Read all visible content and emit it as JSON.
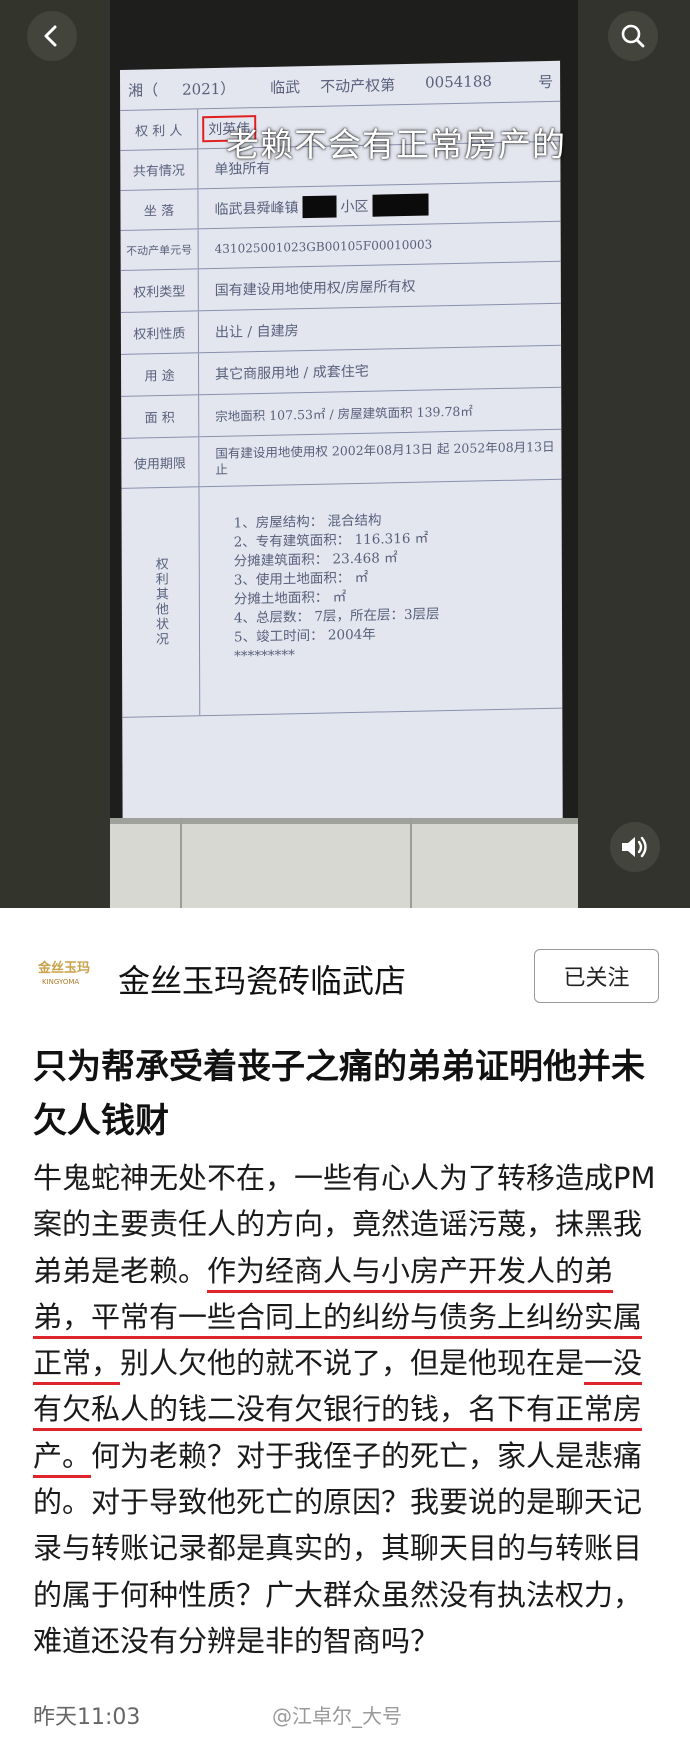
{
  "video": {
    "overlay_caption": "老赖不会有正常房产的",
    "document": {
      "header": {
        "prefix": "湘（",
        "year": "2021）",
        "county": "临武",
        "type": "不动产权第",
        "number": "0054188",
        "suffix": "号"
      },
      "rows": [
        {
          "label": "权 利 人",
          "value": "刘英伟"
        },
        {
          "label": "共有情况",
          "value": "单独所有"
        },
        {
          "label": "坐 落",
          "value_prefix": "临武县舜峰镇",
          "value_mid": "小区"
        },
        {
          "label": "不动产单元号",
          "value": "431025001023GB00105F00010003"
        },
        {
          "label": "权利类型",
          "value": "国有建设用地使用权/房屋所有权"
        },
        {
          "label": "权利性质",
          "value": "出让 / 自建房"
        },
        {
          "label": "用 途",
          "value": "其它商服用地 / 成套住宅"
        },
        {
          "label": "面 积",
          "value": "宗地面积 107.53㎡ / 房屋建筑面积 139.78㎡"
        },
        {
          "label": "使用期限",
          "value": "国有建设用地使用权 2002年08月13日 起 2052年08月13日 止"
        }
      ],
      "other_label": "权利其他状况",
      "other_items": [
        "1、房屋结构：  混合结构",
        "2、专有建筑面积：  116.316 ㎡",
        "   分摊建筑面积：  23.468 ㎡",
        "3、使用土地面积：  ㎡",
        "   分摊土地面积：  ㎡",
        "4、总层数：  7层，所在层：3层层",
        "5、竣工时间：  2004年",
        "*********"
      ]
    }
  },
  "top_bar": {
    "back_icon": "chevron-left-icon",
    "search_icon": "search-icon"
  },
  "sound_icon": "speaker-icon",
  "account": {
    "name": "金丝玉玛瓷砖临武店",
    "logo_text": "金丝玉玛",
    "logo_sub": "KINGYOMA",
    "follow_label": "已关注"
  },
  "post": {
    "title": "只为帮承受着丧子之痛的弟弟证明他并未欠人钱财",
    "p1": "牛鬼蛇神无处不在，一些有心人为了转移造成PM案的主要责任人的方向，竟然造谣污蔑，抹黑我弟弟是老赖。",
    "u1": "作为经商人与小房产开发人的弟弟，平常有一些合同上的纠纷与债务上纠纷实属正常，",
    "p2": "别人欠他的就不说了，但是他现在是",
    "u2": "一没有欠私人的钱二没有欠银行的钱，名下有正常房产。",
    "p3": "何为老赖？对于我侄子的死亡，家人是悲痛的。对于导致他死亡的原因？我要说的是聊天记录与转账记录都是真实的，其聊天目的与转账目的属于何种性质？广大群众虽然没有执法权力，难道还没有分辨是非的智商吗？"
  },
  "footer": {
    "time": "昨天11:03",
    "watermark": "@江卓尔_大号"
  },
  "colors": {
    "accent_underline": "#e0242c",
    "redbox": "#e02020"
  }
}
